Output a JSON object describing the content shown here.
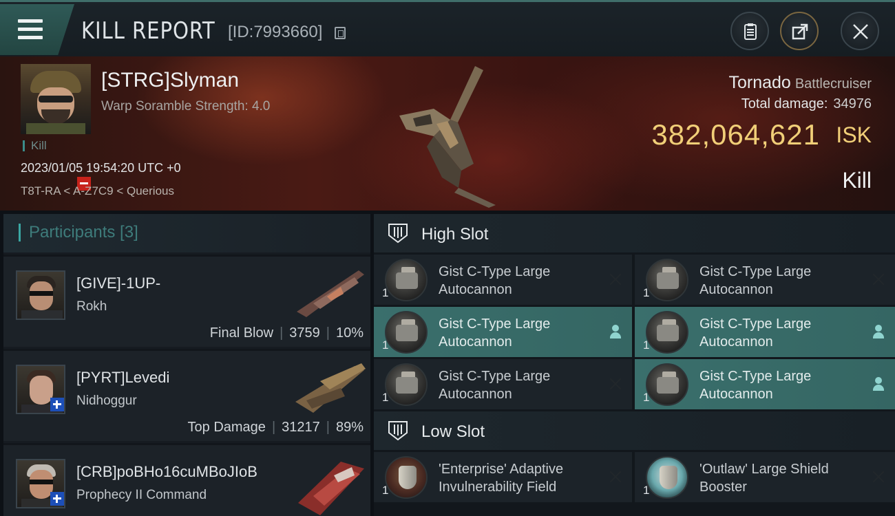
{
  "header": {
    "title": "KILL REPORT",
    "report_id": "[ID:7993660]"
  },
  "victim": {
    "name": "[STRG]Slyman",
    "subtitle": "Warp Soramble Strength: 4.0",
    "tag": "Kill",
    "time": "2023/01/05 19:54:20 UTC +0",
    "location": "T8T-RA < A-Z7C9 < Querious"
  },
  "ship": {
    "name": "Tornado",
    "class": "Battlecruiser",
    "total_damage_label": "Total damage:",
    "total_damage": "34976",
    "isk_value": "382,064,621",
    "isk_unit": "ISK",
    "result": "Kill"
  },
  "participants": {
    "title": "Participants [3]",
    "items": [
      {
        "name": "[GIVE]-1UP-",
        "ship": "Rokh",
        "role": "Final Blow",
        "damage": "3759",
        "percent": "10%"
      },
      {
        "name": "[PYRT]Levedi",
        "ship": "Nidhoggur",
        "role": "Top Damage",
        "damage": "31217",
        "percent": "89%"
      },
      {
        "name": "[CRB]poBHo16cuMBoJIoB",
        "ship": "Prophecy II Command",
        "role": "",
        "damage": "",
        "percent": ""
      }
    ]
  },
  "high_slot": {
    "title": "High Slot",
    "modules": [
      {
        "qty": "1",
        "line1": "Gist C-Type Large",
        "line2": "Autocannon",
        "state": "destroyed"
      },
      {
        "qty": "1",
        "line1": "Gist C-Type Large",
        "line2": "Autocannon",
        "state": "destroyed"
      },
      {
        "qty": "1",
        "line1": "Gist C-Type Large",
        "line2": "Autocannon",
        "state": "dropped"
      },
      {
        "qty": "1",
        "line1": "Gist C-Type Large",
        "line2": "Autocannon",
        "state": "dropped"
      },
      {
        "qty": "1",
        "line1": "Gist C-Type Large",
        "line2": "Autocannon",
        "state": "destroyed"
      },
      {
        "qty": "1",
        "line1": "Gist C-Type Large",
        "line2": "Autocannon",
        "state": "dropped"
      }
    ]
  },
  "low_slot": {
    "title": "Low Slot",
    "modules": [
      {
        "qty": "1",
        "line1": "'Enterprise' Adaptive",
        "line2": "Invulnerability Field",
        "state": "destroyed"
      },
      {
        "qty": "1",
        "line1": "'Outlaw' Large Shield",
        "line2": "Booster",
        "state": "destroyed"
      }
    ]
  },
  "colors": {
    "accent": "#3aa7a3",
    "isk": "#f1cf78",
    "active_module": "#3a6f6c"
  }
}
